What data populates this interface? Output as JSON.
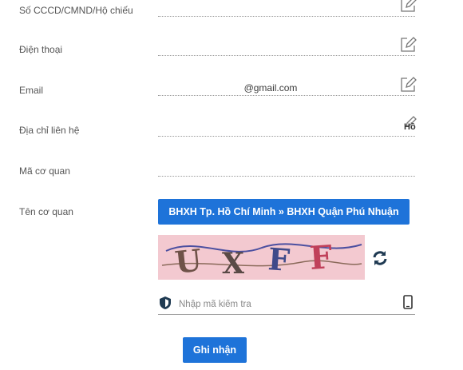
{
  "form": {
    "id_number": {
      "label": "Số CCCD/CMND/Hộ chiếu",
      "value": ""
    },
    "phone": {
      "label": "Điện thoại",
      "value": ""
    },
    "email": {
      "label": "Email",
      "value": "@gmail.com"
    },
    "address": {
      "label": "Địa chỉ liên hệ",
      "value": "",
      "icon_text": "Hồ"
    },
    "agency_code": {
      "label": "Mã cơ quan",
      "value": ""
    },
    "agency_name": {
      "label": "Tên cơ quan",
      "button_label": "BHXH Tp. Hồ Chí Minh » BHXH Quận Phú Nhuận"
    },
    "captcha": {
      "text": "UXFF",
      "placeholder": "Nhập mã kiểm tra"
    },
    "submit_label": "Ghi nhận"
  },
  "colors": {
    "primary": "#1e73d9",
    "captcha_bg": "#f3c9d0"
  },
  "icons": [
    "edit-icon",
    "refresh-icon",
    "shield-icon",
    "phone-icon"
  ]
}
